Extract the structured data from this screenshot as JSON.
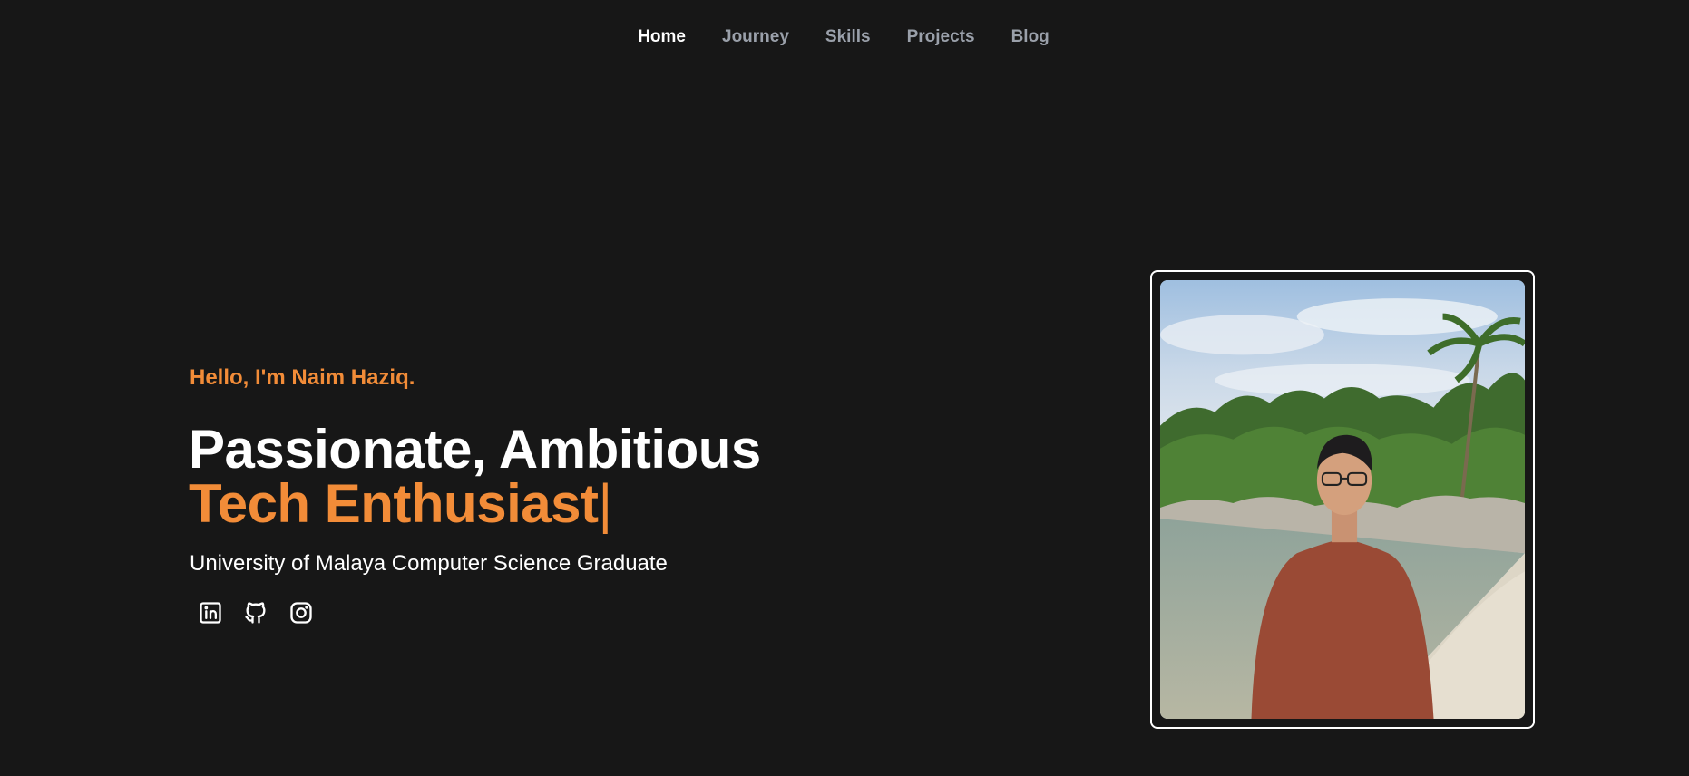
{
  "nav": {
    "items": [
      {
        "label": "Home",
        "active": true
      },
      {
        "label": "Journey",
        "active": false
      },
      {
        "label": "Skills",
        "active": false
      },
      {
        "label": "Projects",
        "active": false
      },
      {
        "label": "Blog",
        "active": false
      }
    ]
  },
  "hero": {
    "greeting": "Hello, I'm Naim Haziq.",
    "headline_line1": "Passionate, Ambitious",
    "headline_line2": "Tech Enthusiast",
    "cursor": "|",
    "subtitle": "University of Malaya Computer Science Graduate"
  },
  "socials": [
    {
      "icon": "linkedin-icon"
    },
    {
      "icon": "github-icon"
    },
    {
      "icon": "instagram-icon"
    }
  ],
  "colors": {
    "background": "#171717",
    "accent": "#f28c38",
    "nav_inactive": "#9aa0aa",
    "text": "#ffffff"
  }
}
